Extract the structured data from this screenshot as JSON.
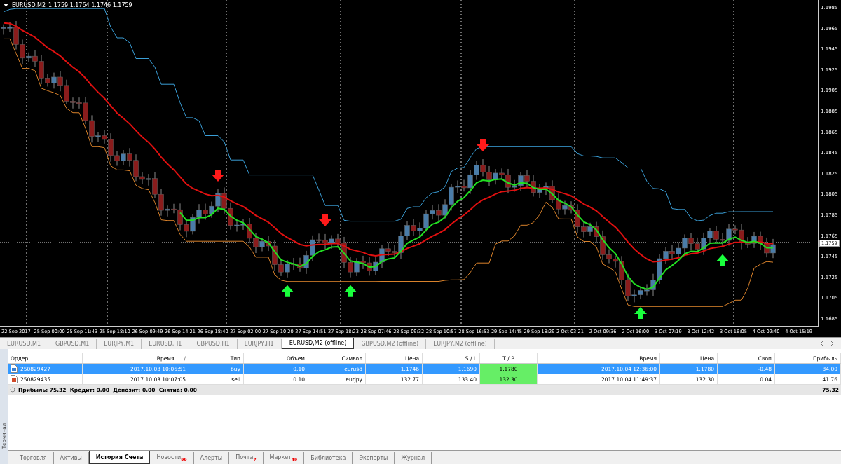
{
  "chart": {
    "symbol": "EURUSD,M2",
    "quotes": "1.1759 1.1764 1.1746 1.1759",
    "current_price": "1.1759",
    "price_labels": [
      "1.1985",
      "1.1965",
      "1.1945",
      "1.1925",
      "1.1905",
      "1.1885",
      "1.1865",
      "1.1845",
      "1.1825",
      "1.1805",
      "1.1785",
      "1.1765",
      "1.1745",
      "1.1725",
      "1.1705",
      "1.1685"
    ],
    "time_labels": [
      "22 Sep 2017",
      "25 Sep 00:00",
      "25 Sep 11:43",
      "25 Sep 18:10",
      "26 Sep 09:49",
      "26 Sep 14:21",
      "26 Sep 18:40",
      "27 Sep 02:00",
      "27 Sep 10:20",
      "27 Sep 14:51",
      "27 Sep 18:23",
      "28 Sep 07:46",
      "28 Sep 09:32",
      "28 Sep 10:57",
      "28 Sep 16:53",
      "29 Sep 14:45",
      "29 Sep 18:29",
      "2 Oct 03:21",
      "2 Oct 09:36",
      "2 Oct 16:00",
      "3 Oct 07:19",
      "3 Oct 12:42",
      "3 Oct 16:05",
      "4 Oct 02:40",
      "4 Oct 15:19"
    ]
  },
  "symbol_tabs": [
    {
      "label": "EURUSD,M1",
      "selected": false
    },
    {
      "label": "GBPUSD,M1",
      "selected": false
    },
    {
      "label": "EURJPY,M1",
      "selected": false
    },
    {
      "label": "EURUSD,H1",
      "selected": false
    },
    {
      "label": "GBPUSD,H1",
      "selected": false
    },
    {
      "label": "EURJPY,H1",
      "selected": false
    },
    {
      "label": "EURUSD,M2 (offline)",
      "selected": true
    },
    {
      "label": "GBPUSD,M2 (offline)",
      "selected": false
    },
    {
      "label": "EURJPY,M2 (offline)",
      "selected": false
    }
  ],
  "orders": {
    "columns": [
      {
        "label": "Ордер"
      },
      {
        "label": "Время",
        "sort": "/"
      },
      {
        "label": "Тип"
      },
      {
        "label": "Объем"
      },
      {
        "label": "Символ"
      },
      {
        "label": "Цена"
      },
      {
        "label": "S / L"
      },
      {
        "label": "T / P"
      },
      {
        "label": "Время"
      },
      {
        "label": "Цена"
      },
      {
        "label": "Своп"
      },
      {
        "label": "Прибыль"
      }
    ],
    "rows": [
      {
        "kind": "buy",
        "selected": true,
        "cells": [
          "250829427",
          "2017.10.03 10:06:51",
          "buy",
          "0.10",
          "eurusd",
          "1.1746",
          "1.1690",
          "1.1780",
          "2017.10.04 12:36:00",
          "1.1780",
          "-0.48",
          "34.00"
        ]
      },
      {
        "kind": "sell",
        "selected": false,
        "cells": [
          "250829435",
          "2017.10.03 10:07:05",
          "sell",
          "0.10",
          "eurjpy",
          "132.77",
          "133.40",
          "132.30",
          "2017.10.04 11:49:37",
          "132.30",
          "0.04",
          "41.76"
        ]
      }
    ],
    "summary": {
      "text": "Прибыль: 75.32  Кредит: 0.00  Депозит: 0.00  Снятие: 0.00",
      "total": "75.32"
    }
  },
  "terminal_label": "Терминал",
  "bottom_tabs": [
    {
      "label": "Торговля",
      "selected": false
    },
    {
      "label": "Активы",
      "selected": false
    },
    {
      "label": "История Счета",
      "selected": true
    },
    {
      "label": "Новости",
      "badge": "99",
      "selected": false
    },
    {
      "label": "Алерты",
      "selected": false
    },
    {
      "label": "Почта",
      "badge": "7",
      "selected": false
    },
    {
      "label": "Маркет",
      "badge": "49",
      "selected": false
    },
    {
      "label": "Библиотека",
      "selected": false
    },
    {
      "label": "Эксперты",
      "selected": false
    },
    {
      "label": "Журнал",
      "selected": false
    }
  ]
}
